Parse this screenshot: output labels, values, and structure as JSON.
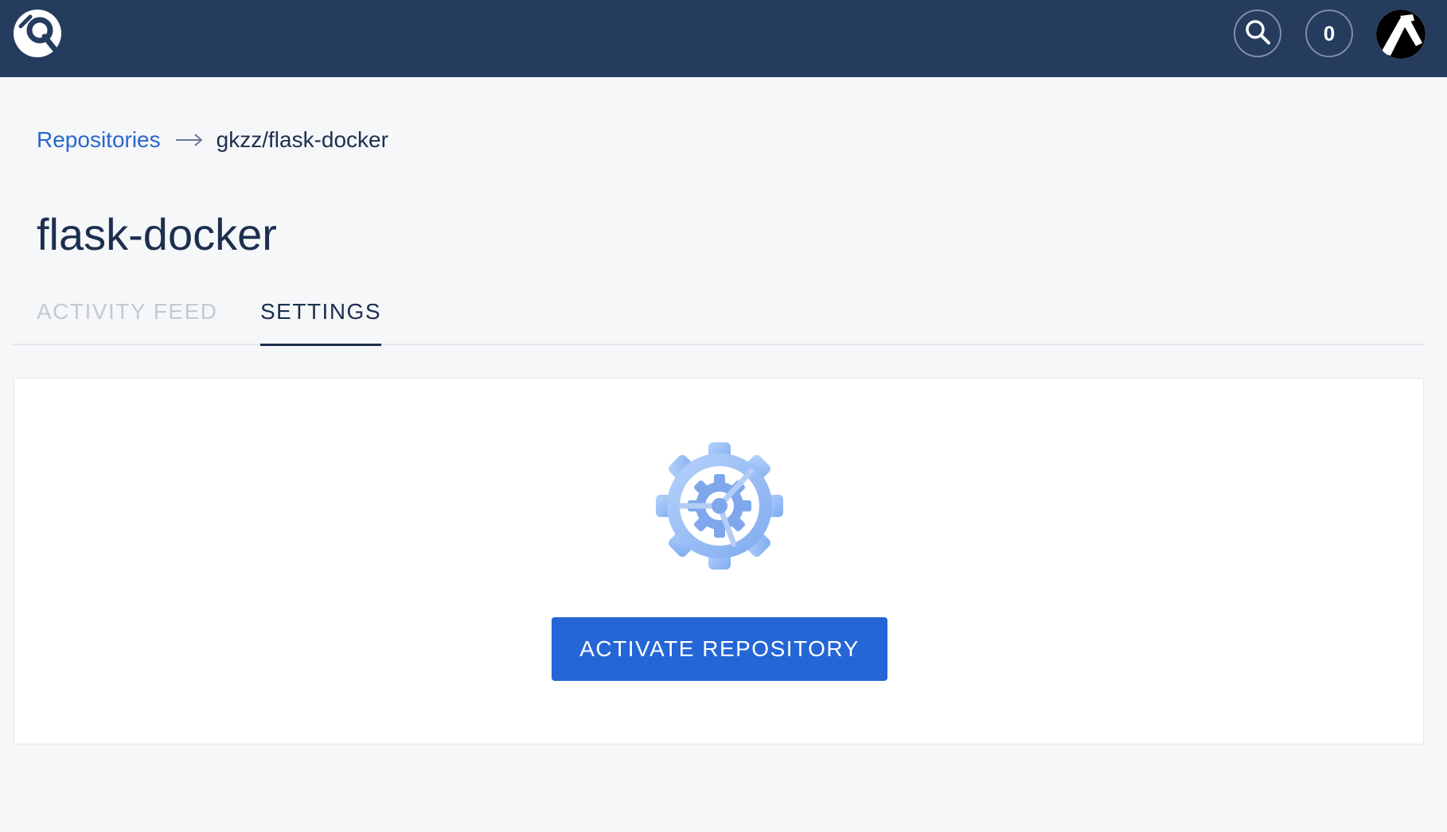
{
  "header": {
    "notifications_count": "0",
    "icons": {
      "logo": "app-logo-icon",
      "search": "search-icon",
      "avatar": "user-avatar"
    },
    "background_color": "#253c5f"
  },
  "breadcrumb": {
    "root_label": "Repositories",
    "current_label": "gkzz/flask-docker"
  },
  "page": {
    "title": "flask-docker"
  },
  "tabs": [
    {
      "label": "ACTIVITY FEED",
      "active": false
    },
    {
      "label": "SETTINGS",
      "active": true
    }
  ],
  "panel": {
    "illustration_icon": "settings-gear-icon",
    "activate_label": "ACTIVATE REPOSITORY",
    "accent_color": "#2566d6"
  }
}
